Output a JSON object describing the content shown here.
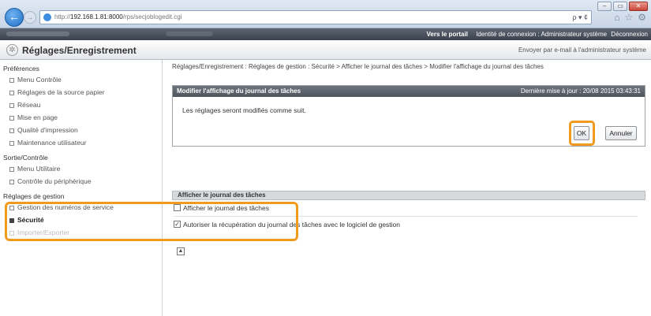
{
  "browser": {
    "url_prefix": "http://",
    "url_host": "192.168.1.81:8000",
    "url_path": "/rps/secjoblogedit.cgi",
    "address_tools": "ρ ▾ ¢",
    "window_controls": [
      "–",
      "▭",
      "✕"
    ]
  },
  "topbar": {
    "portal": "Vers le portail",
    "login_label": "Identité de connexion : Administrateur système",
    "logout": "Déconnexion"
  },
  "header": {
    "title": "Réglages/Enregistrement",
    "email_link": "Envoyer par e-mail à l'administrateur système"
  },
  "sidebar": {
    "groups": [
      {
        "label": "Préférences",
        "items": [
          "Menu Contrôle",
          "Réglages de la source papier",
          "Réseau",
          "Mise en page",
          "Qualité d'impression",
          "Maintenance utilisateur"
        ]
      },
      {
        "label": "Sortie/Contrôle",
        "items": [
          "Menu Utilitaire",
          "Contrôle du périphérique"
        ]
      },
      {
        "label": "Réglages de gestion",
        "items": [
          "Gestion des numéros de service",
          "Sécurité",
          "Importer/Exporter"
        ]
      }
    ]
  },
  "main": {
    "breadcrumb": "Réglages/Enregistrement : Réglages de gestion : Sécurité > Afficher le journal des tâches > Modifier l'affichage du journal des tâches",
    "panel_title": "Modifier l'affichage du journal des tâches",
    "last_update": "Dernière mise à jour : 20/08 2015 03:43:31",
    "message": "Les réglages seront modifiés comme suit.",
    "ok_label": "OK",
    "cancel_label": "Annuler",
    "section_title": "Afficher le journal des tâches",
    "options": [
      {
        "label": "Afficher le journal des tâches",
        "checked": false
      },
      {
        "label": "Autoriser la récupération du journal des tâches avec le logiciel de gestion",
        "checked": true
      }
    ]
  },
  "colors": {
    "highlight": "#f29a1d",
    "panel_header": "#4e555e",
    "topbar": "#3b424d"
  }
}
